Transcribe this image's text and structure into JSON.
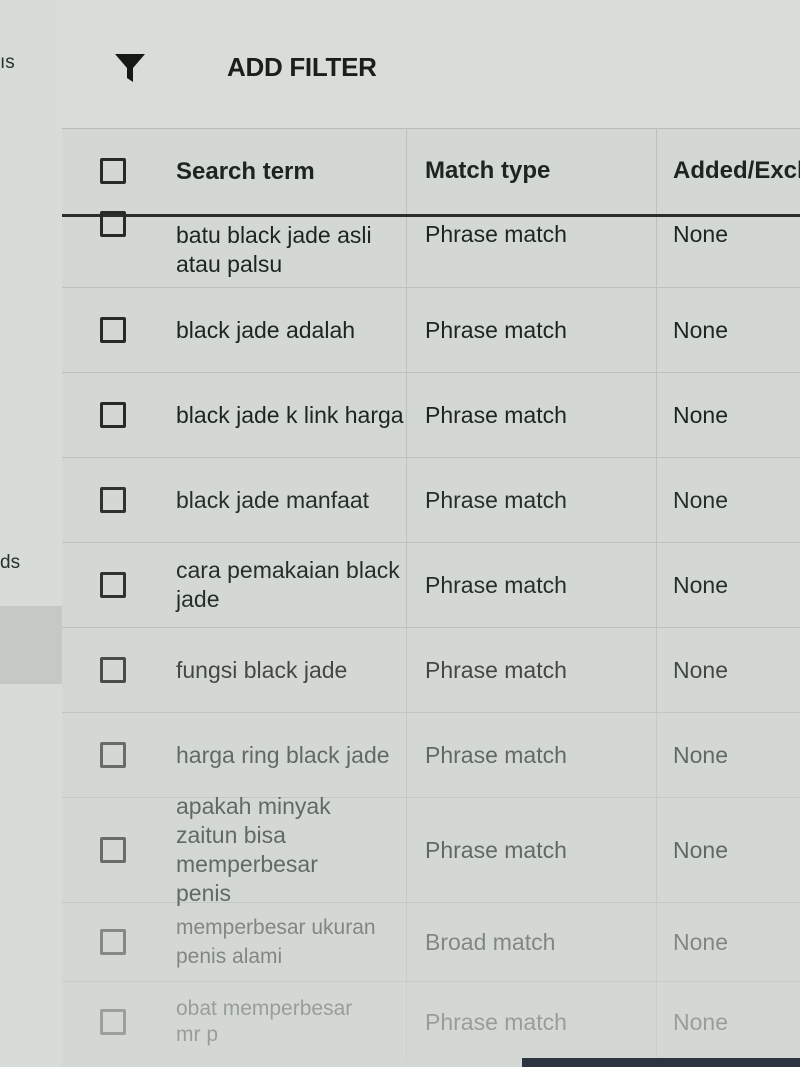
{
  "sidebar": {
    "fragments": [
      "ıs",
      "ds"
    ]
  },
  "toolbar": {
    "filter_icon": "filter-funnel-icon",
    "add_filter_label": "ADD FILTER"
  },
  "table": {
    "columns": [
      "Search term",
      "Match type",
      "Added/Excl"
    ],
    "rows": [
      {
        "term": "batu black jade asli atau palsu",
        "match": "Phrase match",
        "added": "None"
      },
      {
        "term": "black jade adalah",
        "match": "Phrase match",
        "added": "None"
      },
      {
        "term": "black jade k link harga",
        "match": "Phrase match",
        "added": "None"
      },
      {
        "term": "black jade manfaat",
        "match": "Phrase match",
        "added": "None"
      },
      {
        "term": "cara pemakaian black jade",
        "match": "Phrase match",
        "added": "None"
      },
      {
        "term": "fungsi black jade",
        "match": "Phrase match",
        "added": "None"
      },
      {
        "term": "harga ring black jade",
        "match": "Phrase match",
        "added": "None"
      },
      {
        "term": "apakah minyak zaitun bisa memperbesar penis",
        "match": "Phrase match",
        "added": "None"
      },
      {
        "term": "memperbesar ukuran penis alami",
        "match": "Broad match",
        "added": "None"
      },
      {
        "term": "obat memperbesar mr p",
        "match": "Phrase match",
        "added": "None"
      }
    ]
  }
}
